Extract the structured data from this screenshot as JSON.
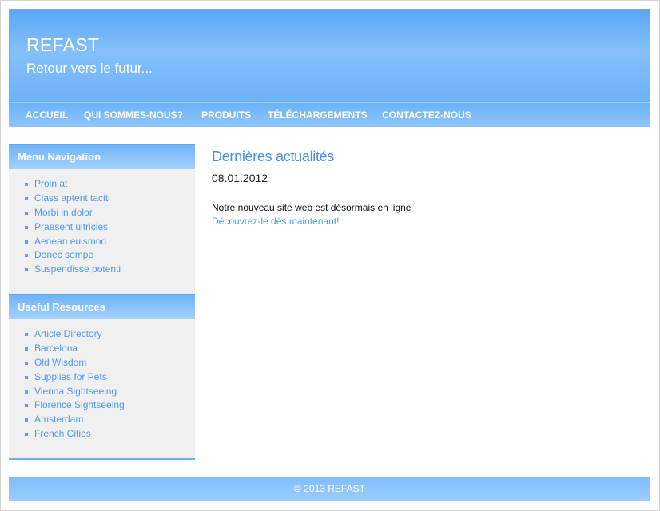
{
  "header": {
    "title": "REFAST",
    "tagline": "Retour vers le futur..."
  },
  "nav": {
    "items": [
      "ACCUEIL",
      "QUI SOMMES-NOUS?",
      "PRODUITS",
      "TÉLÉCHARGEMENTS",
      "CONTACTEZ-NOUS"
    ]
  },
  "sidebar": {
    "navigation": {
      "heading": "Menu Navigation",
      "items": [
        "Proin at",
        "Class aptent taciti",
        "Morbi in dolor",
        "Praesent ultricies",
        "Aenean euismod",
        "Donec sempe",
        "Suspendisse potenti"
      ]
    },
    "resources": {
      "heading": "Useful Resources",
      "items": [
        "Article Directory",
        "Barcelona",
        "Old Wisdom",
        "Supplies for Pets",
        "Vienna Sightseeing",
        "Florence Sightseeing",
        "Amsterdam",
        "French Cities"
      ]
    }
  },
  "main": {
    "title": "Dernières actualités",
    "date": "08.01.2012",
    "text": "Notre nouveau site web est désormais en ligne",
    "link": "Découvrez-le dès maintenant!"
  },
  "footer": {
    "text": "© 2013 REFAST"
  },
  "colors": {
    "accent": "#6cb1f8",
    "link": "#4f9ae8",
    "sidebar_bg": "#f0f0f0"
  }
}
